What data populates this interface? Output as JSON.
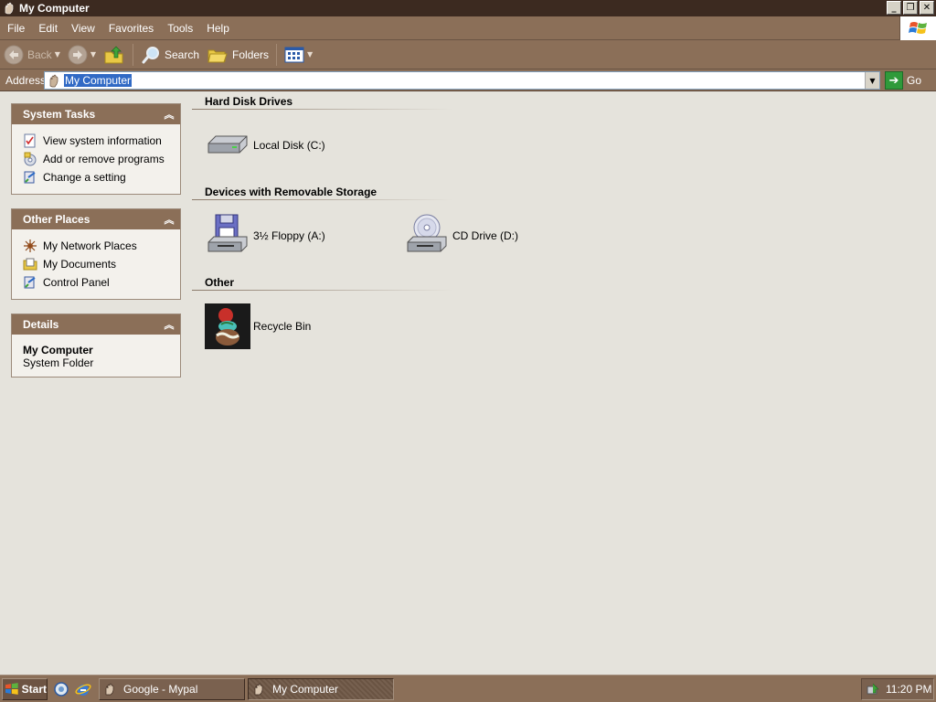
{
  "window": {
    "title": "My Computer",
    "minimize_label": "_",
    "maximize_label": "❐",
    "close_label": "✕"
  },
  "menu": {
    "items": [
      "File",
      "Edit",
      "View",
      "Favorites",
      "Tools",
      "Help"
    ]
  },
  "toolbar": {
    "back_label": "Back",
    "search_label": "Search",
    "folders_label": "Folders"
  },
  "address": {
    "label": "Address",
    "value": "My Computer",
    "go_label": "Go"
  },
  "taskpane": {
    "system_tasks": {
      "title": "System Tasks",
      "items": [
        "View system information",
        "Add or remove programs",
        "Change a setting"
      ]
    },
    "other_places": {
      "title": "Other Places",
      "items": [
        "My Network Places",
        "My Documents",
        "Control Panel"
      ]
    },
    "details": {
      "title": "Details",
      "name": "My Computer",
      "type": "System Folder"
    }
  },
  "content": {
    "groups": [
      {
        "title": "Hard Disk Drives",
        "items": [
          "Local Disk (C:)"
        ]
      },
      {
        "title": "Devices with Removable Storage",
        "items": [
          "3½ Floppy (A:)",
          "CD Drive (D:)"
        ]
      },
      {
        "title": "Other",
        "items": [
          "Recycle Bin"
        ]
      }
    ]
  },
  "taskbar": {
    "start_label": "Start",
    "tasks": [
      {
        "label": "Google - Mypal",
        "active": false
      },
      {
        "label": "My Computer",
        "active": true
      }
    ],
    "clock": "11:20 PM"
  },
  "colors": {
    "title_bg": "#3c2a20",
    "bar_bg": "#8b6f58",
    "window_bg": "#e5e3dc",
    "selection": "#316ac5"
  }
}
